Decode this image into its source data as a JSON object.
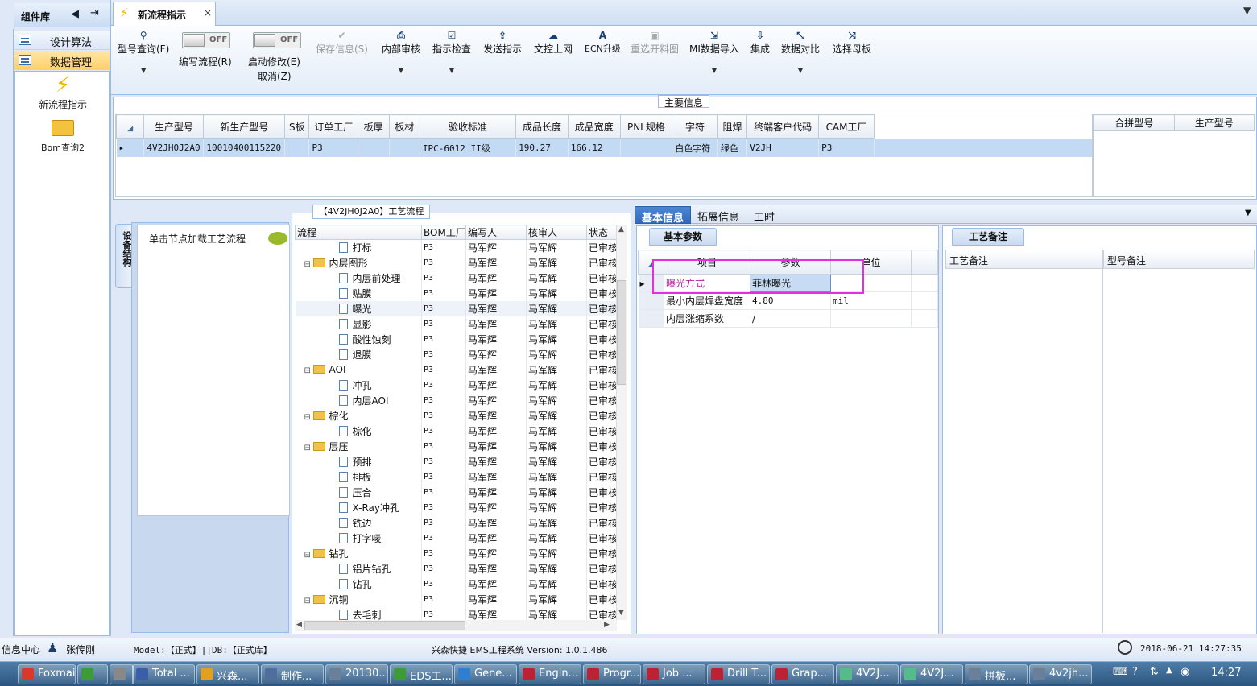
{
  "sidebar": {
    "title": "组件库",
    "items": [
      {
        "label": "设计算法"
      },
      {
        "label": "数据管理"
      }
    ],
    "launchers": [
      {
        "label": "新流程指示"
      },
      {
        "label": "Bom查询2"
      }
    ]
  },
  "tab": {
    "label": "新流程指示",
    "close": "×",
    "dropdown": "▼"
  },
  "toolbar": {
    "type_query": "型号查询(F)",
    "write_flow": "编写流程(R)",
    "start_modify": "启动修改(E)",
    "cancel": "取消(Z)",
    "toggle_off": "OFF",
    "save_info": "保存信息(S)",
    "internal_review": "内部审核",
    "instruction_check": "指示检查",
    "send_instruction": "发送指示",
    "upload_doc": "文控上网",
    "ecn_upgrade": "ECN升级",
    "reselect_image": "重选开料图",
    "mi_import": "MI数据导入",
    "integrate": "集成",
    "data_compare": "数据对比",
    "select_mother": "选择母板"
  },
  "main_info": {
    "title": "主要信息",
    "columns": [
      "生产型号",
      "新生产型号",
      "S板",
      "订单工厂",
      "板厚",
      "板材",
      "验收标准",
      "成品长度",
      "成品宽度",
      "PNL规格",
      "字符",
      "阻焊",
      "终端客户代码",
      "CAM工厂"
    ],
    "row": [
      "4V2JH0J2A0",
      "10010400115220",
      "",
      "P3",
      "",
      "",
      "IPC-6012 II级",
      "190.27",
      "166.12",
      "",
      "白色字符",
      "绿色",
      "V2JH",
      "P3"
    ],
    "side_columns": [
      "合拼型号",
      "生产型号"
    ]
  },
  "structure": {
    "tab_label": "设备结构",
    "hint": "单击节点加载工艺流程"
  },
  "flow": {
    "title": "【4V2JH0J2A0】工艺流程",
    "columns": [
      "流程",
      "BOM工厂",
      "编写人",
      "核审人",
      "状态"
    ],
    "rows": [
      {
        "label": "打标",
        "level": 2,
        "type": "doc",
        "bom": "P3",
        "writer": "马军辉",
        "reviewer": "马军辉",
        "status": "已审核"
      },
      {
        "label": "内层图形",
        "level": 1,
        "type": "folder",
        "bom": "P3",
        "writer": "马军辉",
        "reviewer": "马军辉",
        "status": "已审核"
      },
      {
        "label": "内层前处理",
        "level": 2,
        "type": "doc",
        "bom": "P3",
        "writer": "马军辉",
        "reviewer": "马军辉",
        "status": "已审核"
      },
      {
        "label": "贴膜",
        "level": 2,
        "type": "doc",
        "bom": "P3",
        "writer": "马军辉",
        "reviewer": "马军辉",
        "status": "已审核"
      },
      {
        "label": "曝光",
        "level": 2,
        "type": "doc",
        "bom": "P3",
        "writer": "马军辉",
        "reviewer": "马军辉",
        "status": "已审核"
      },
      {
        "label": "显影",
        "level": 2,
        "type": "doc",
        "bom": "P3",
        "writer": "马军辉",
        "reviewer": "马军辉",
        "status": "已审核"
      },
      {
        "label": "酸性蚀刻",
        "level": 2,
        "type": "doc",
        "bom": "P3",
        "writer": "马军辉",
        "reviewer": "马军辉",
        "status": "已审核"
      },
      {
        "label": "退膜",
        "level": 2,
        "type": "doc",
        "bom": "P3",
        "writer": "马军辉",
        "reviewer": "马军辉",
        "status": "已审核"
      },
      {
        "label": "AOI",
        "level": 1,
        "type": "folder",
        "bom": "P3",
        "writer": "马军辉",
        "reviewer": "马军辉",
        "status": "已审核"
      },
      {
        "label": "冲孔",
        "level": 2,
        "type": "doc",
        "bom": "P3",
        "writer": "马军辉",
        "reviewer": "马军辉",
        "status": "已审核"
      },
      {
        "label": "内层AOI",
        "level": 2,
        "type": "doc",
        "bom": "P3",
        "writer": "马军辉",
        "reviewer": "马军辉",
        "status": "已审核"
      },
      {
        "label": "棕化",
        "level": 1,
        "type": "folder",
        "bom": "P3",
        "writer": "马军辉",
        "reviewer": "马军辉",
        "status": "已审核"
      },
      {
        "label": "棕化",
        "level": 2,
        "type": "doc",
        "bom": "P3",
        "writer": "马军辉",
        "reviewer": "马军辉",
        "status": "已审核"
      },
      {
        "label": "层压",
        "level": 1,
        "type": "folder",
        "bom": "P3",
        "writer": "马军辉",
        "reviewer": "马军辉",
        "status": "已审核"
      },
      {
        "label": "预排",
        "level": 2,
        "type": "doc",
        "bom": "P3",
        "writer": "马军辉",
        "reviewer": "马军辉",
        "status": "已审核"
      },
      {
        "label": "排板",
        "level": 2,
        "type": "doc",
        "bom": "P3",
        "writer": "马军辉",
        "reviewer": "马军辉",
        "status": "已审核"
      },
      {
        "label": "压合",
        "level": 2,
        "type": "doc",
        "bom": "P3",
        "writer": "马军辉",
        "reviewer": "马军辉",
        "status": "已审核"
      },
      {
        "label": "X-Ray冲孔",
        "level": 2,
        "type": "doc",
        "bom": "P3",
        "writer": "马军辉",
        "reviewer": "马军辉",
        "status": "已审核"
      },
      {
        "label": "铣边",
        "level": 2,
        "type": "doc",
        "bom": "P3",
        "writer": "马军辉",
        "reviewer": "马军辉",
        "status": "已审核"
      },
      {
        "label": "打字唛",
        "level": 2,
        "type": "doc",
        "bom": "P3",
        "writer": "马军辉",
        "reviewer": "马军辉",
        "status": "已审核"
      },
      {
        "label": "钻孔",
        "level": 1,
        "type": "folder",
        "bom": "P3",
        "writer": "马军辉",
        "reviewer": "马军辉",
        "status": "已审核"
      },
      {
        "label": "铝片钻孔",
        "level": 2,
        "type": "doc",
        "bom": "P3",
        "writer": "马军辉",
        "reviewer": "马军辉",
        "status": "已审核"
      },
      {
        "label": "钻孔",
        "level": 2,
        "type": "doc",
        "bom": "P3",
        "writer": "马军辉",
        "reviewer": "马军辉",
        "status": "已审核"
      },
      {
        "label": "沉铜",
        "level": 1,
        "type": "folder",
        "bom": "P3",
        "writer": "马军辉",
        "reviewer": "马军辉",
        "status": "已审核"
      },
      {
        "label": "去毛刺",
        "level": 2,
        "type": "doc",
        "bom": "P3",
        "writer": "马军辉",
        "reviewer": "马军辉",
        "status": "已审核"
      }
    ]
  },
  "right_tabs": [
    "基本信息",
    "拓展信息",
    "工时"
  ],
  "params": {
    "tab": "基本参数",
    "columns": [
      "项目",
      "参数",
      "单位"
    ],
    "rows": [
      {
        "name": "曝光方式",
        "value": "菲林曝光",
        "unit": ""
      },
      {
        "name": "最小内层焊盘宽度",
        "value": "4.80",
        "unit": "mil"
      },
      {
        "name": "内层涨缩系数",
        "value": "/",
        "unit": ""
      }
    ]
  },
  "notes": {
    "tab": "工艺备注",
    "columns": [
      "工艺备注",
      "型号备注"
    ]
  },
  "status": {
    "info_center": "信息中心",
    "user": "张传刚",
    "model": "Model:【正式】||DB:【正式库】",
    "system": "兴森快捷 EMS工程系统 Version: 1.0.1.486",
    "datetime": "2018-06-21 14:27:35"
  },
  "taskbar": {
    "items": [
      "Foxmail",
      "",
      "",
      "Total ...",
      "兴森...",
      "制作...",
      "20130...",
      "EDS工...",
      "Gene...",
      "Engin...",
      "Progr...",
      "Job ...",
      "Drill T...",
      "Grap...",
      "4V2J...",
      "4V2J...",
      "拼板...",
      "4v2jh..."
    ],
    "clock": "14:27"
  }
}
